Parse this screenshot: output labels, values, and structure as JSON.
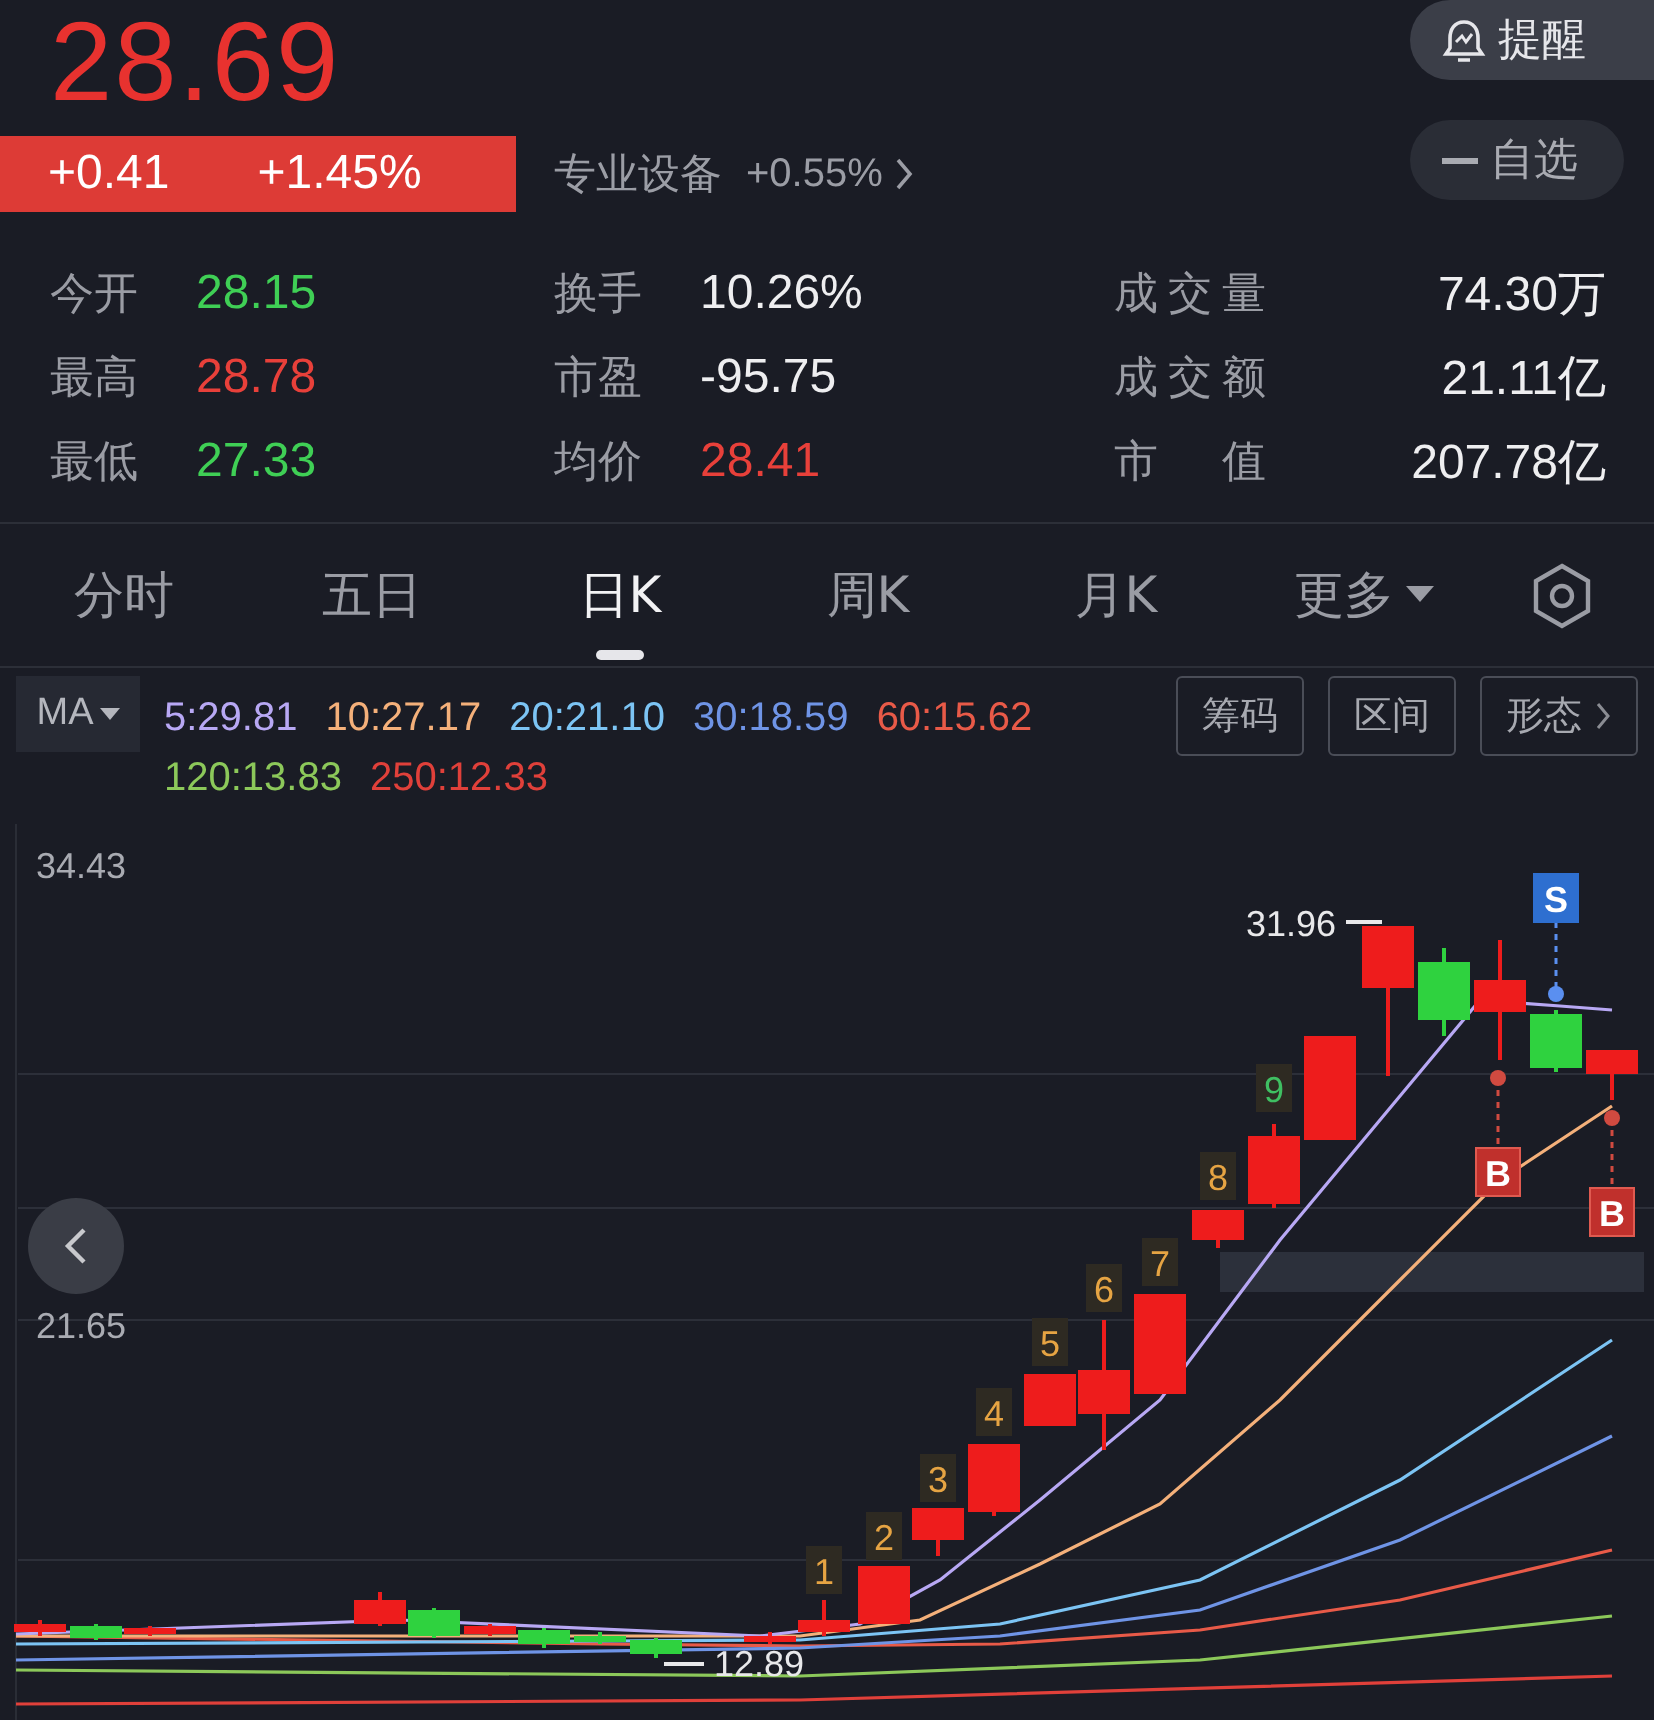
{
  "quote": {
    "price": "28.69",
    "change": "+0.41",
    "change_pct": "+1.45%",
    "sector": "专业设备",
    "sector_change": "+0.55%"
  },
  "buttons": [
    {
      "label": "提醒",
      "kind": "alert"
    },
    {
      "label": "自选",
      "kind": "watch"
    }
  ],
  "stats": [
    {
      "label": "今开",
      "value": "28.15",
      "color": "#3fcf55"
    },
    {
      "label": "换手",
      "value": "10.26%",
      "color": "#eeeef0"
    },
    {
      "label": "成交量",
      "value": "74.30万",
      "color": "#eeeef0"
    },
    {
      "label": "最高",
      "value": "28.78",
      "color": "#e8403a"
    },
    {
      "label": "市盈",
      "value": "-95.75",
      "color": "#eeeef0"
    },
    {
      "label": "成交额",
      "value": "21.11亿",
      "color": "#eeeef0"
    },
    {
      "label": "最低",
      "value": "27.33",
      "color": "#3fcf55"
    },
    {
      "label": "均价",
      "value": "28.41",
      "color": "#e8403a"
    },
    {
      "label": "市 值",
      "value": "207.78亿",
      "color": "#eeeef0"
    }
  ],
  "tabs": [
    {
      "label": "分时",
      "selected": false,
      "kind": "tab"
    },
    {
      "label": "五日",
      "selected": false,
      "kind": "tab"
    },
    {
      "label": "日K",
      "selected": true,
      "kind": "tab"
    },
    {
      "label": "周K",
      "selected": false,
      "kind": "tab"
    },
    {
      "label": "月K",
      "selected": false,
      "kind": "tab"
    },
    {
      "label": "更多",
      "selected": false,
      "kind": "menu"
    }
  ],
  "indicator": {
    "label": "MA"
  },
  "ma_values": [
    {
      "text": "5:29.81",
      "color": "#b8a8f4"
    },
    {
      "text": "10:27.17",
      "color": "#f4b07a"
    },
    {
      "text": "20:21.10",
      "color": "#7cc4f4"
    },
    {
      "text": "30:18.59",
      "color": "#6f94e6"
    },
    {
      "text": "60:15.62",
      "color": "#e85a48"
    },
    {
      "text": "120:13.83",
      "color": "#8cc85a"
    },
    {
      "text": "250:12.33",
      "color": "#e0403a"
    }
  ],
  "tools": [
    {
      "label": "筹码",
      "kind": "plain"
    },
    {
      "label": "区间",
      "kind": "plain"
    },
    {
      "label": "形态",
      "kind": "more"
    }
  ],
  "chart": {
    "y_labels": [
      "34.43",
      "21.65"
    ],
    "high_label": "31.96",
    "low_label": "12.89",
    "count_marks": [
      {
        "text": "1",
        "color": "#e6a443"
      },
      {
        "text": "2",
        "color": "#e6a443"
      },
      {
        "text": "3",
        "color": "#e6a443"
      },
      {
        "text": "4",
        "color": "#e6a443"
      },
      {
        "text": "5",
        "color": "#e6a443"
      },
      {
        "text": "6",
        "color": "#e6a443"
      },
      {
        "text": "7",
        "color": "#e6a443"
      },
      {
        "text": "8",
        "color": "#e6a443"
      },
      {
        "text": "9",
        "color": "#3fbf62"
      }
    ],
    "signals": [
      {
        "text": "S",
        "kind": "sell"
      },
      {
        "text": "B",
        "kind": "buy"
      },
      {
        "text": "B",
        "kind": "buy"
      }
    ]
  }
}
